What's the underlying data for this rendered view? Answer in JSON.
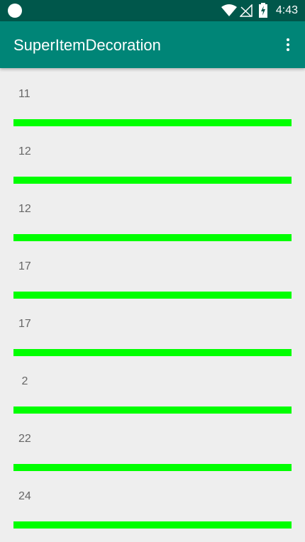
{
  "status_bar": {
    "time": "4:43",
    "icons": [
      "notification-dot-icon",
      "wifi-icon",
      "no-signal-icon",
      "battery-charging-icon"
    ]
  },
  "app_bar": {
    "title": "SuperItemDecoration",
    "menu_icon": "overflow-menu-icon"
  },
  "list": {
    "items": [
      {
        "label": "11"
      },
      {
        "label": "12"
      },
      {
        "label": "12"
      },
      {
        "label": "17"
      },
      {
        "label": "17"
      },
      {
        "label": " 2"
      },
      {
        "label": "22"
      },
      {
        "label": "24"
      }
    ]
  },
  "colors": {
    "status_bar": "#00574b",
    "app_bar": "#008577",
    "divider": "#00ff00",
    "background": "#eeeeee",
    "item_text": "#666666"
  }
}
